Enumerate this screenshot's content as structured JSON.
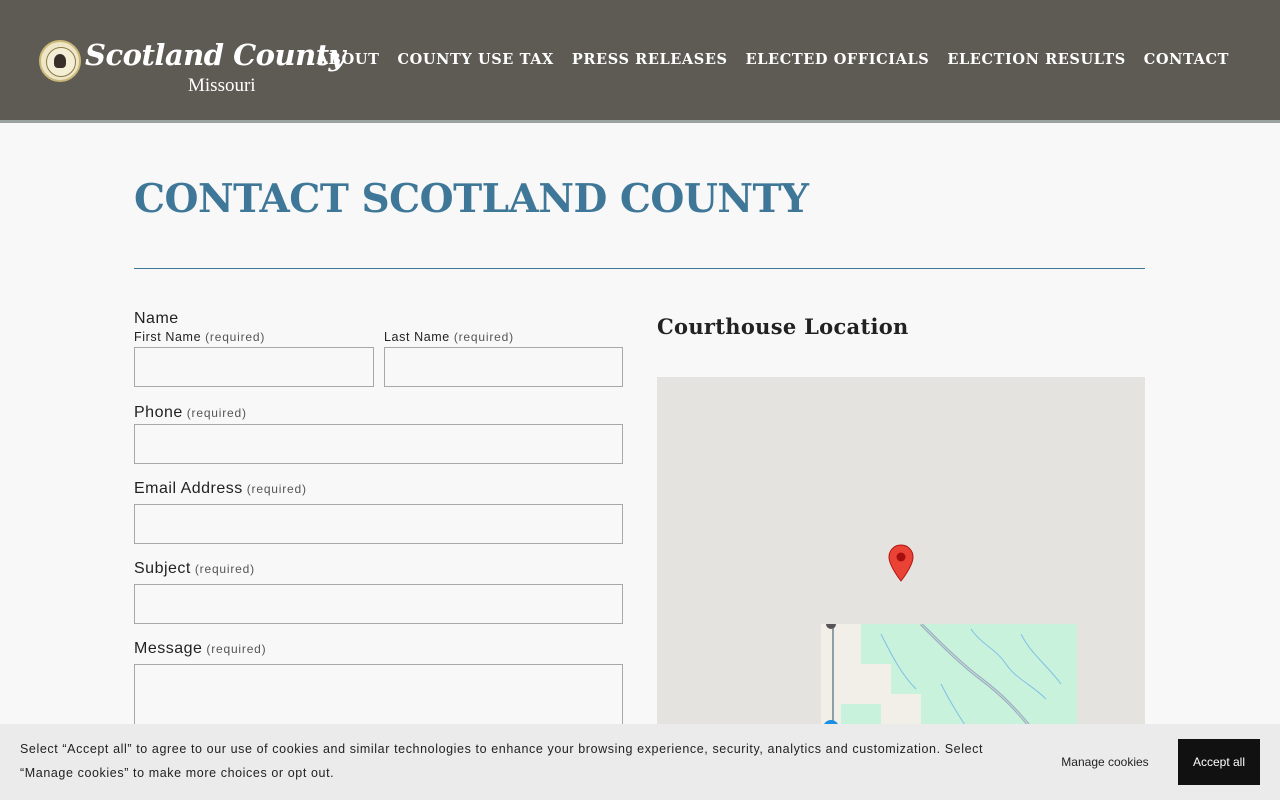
{
  "site": {
    "logo_title": "Scotland County",
    "logo_subtitle": "Missouri",
    "logo_icon": "county-seal-icon"
  },
  "nav": {
    "items": [
      {
        "label": "ABOUT"
      },
      {
        "label": "COUNTY USE TAX"
      },
      {
        "label": "PRESS RELEASES"
      },
      {
        "label": "ELECTED OFFICIALS"
      },
      {
        "label": "ELECTION RESULTS"
      },
      {
        "label": "CONTACT"
      }
    ]
  },
  "main": {
    "title": "CONTACT SCOTLAND COUNTY"
  },
  "form": {
    "name_label": "Name",
    "first_name_label": "First Name",
    "last_name_label": "Last Name",
    "phone_label": "Phone",
    "email_label": "Email Address",
    "subject_label": "Subject",
    "message_label": "Message",
    "required_text": "(required)",
    "first_name_value": "",
    "last_name_value": "",
    "phone_value": "",
    "email_value": "",
    "subject_value": "",
    "message_value": ""
  },
  "map": {
    "heading": "Courthouse Location",
    "marker_icon": "map-pin-icon"
  },
  "cookie_banner": {
    "text": "Select “Accept all” to agree to our use of cookies and similar technologies to enhance your browsing experience, security, analytics and customization. Select “Manage cookies” to make more choices or opt out.",
    "manage_label": "Manage cookies",
    "accept_label": "Accept all"
  },
  "colors": {
    "header_bg": "#5d5b54",
    "accent": "#3e7797",
    "marker": "#ea4335",
    "accept_button": "#111111"
  }
}
